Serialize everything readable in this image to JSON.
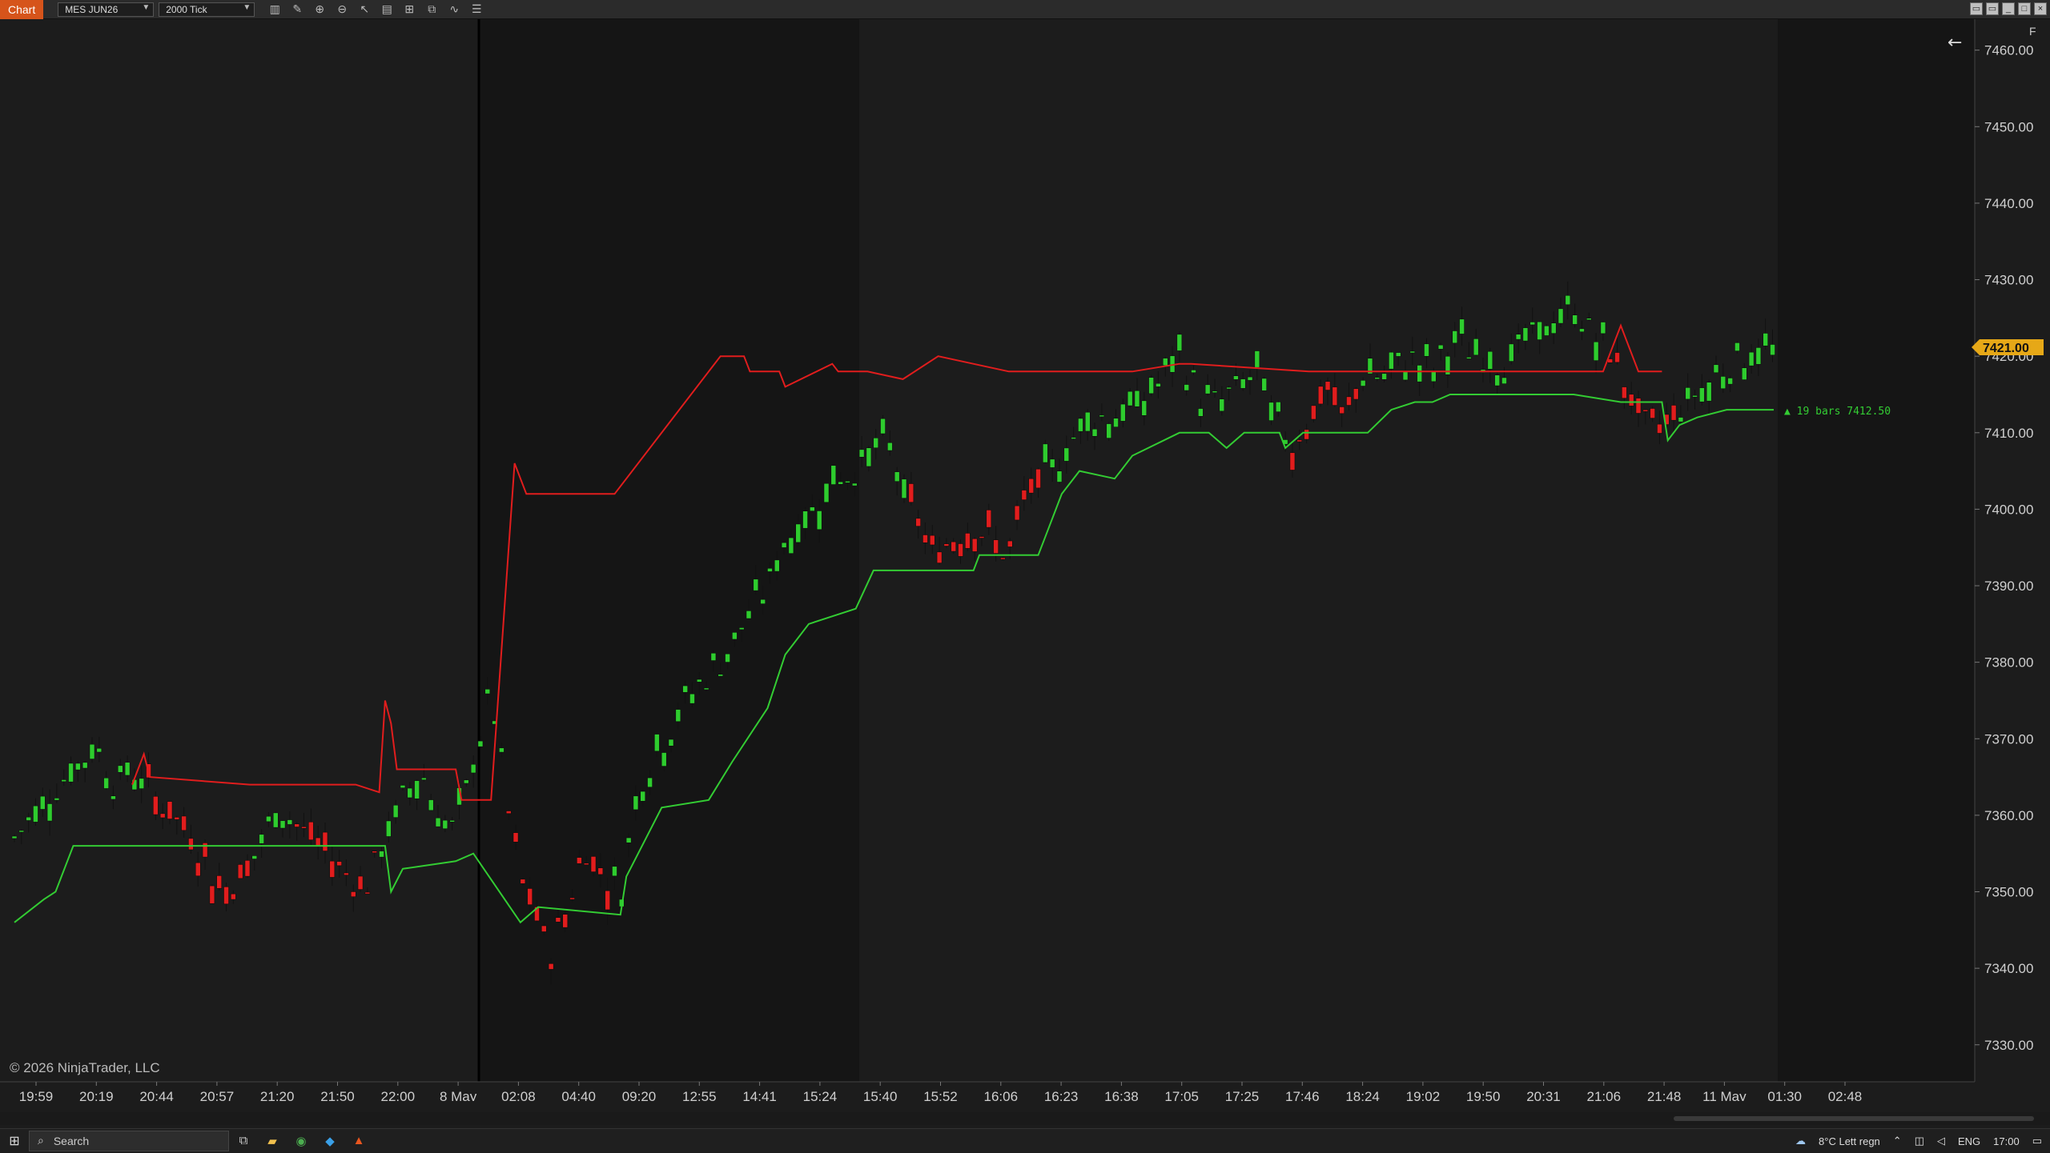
{
  "toolbar": {
    "chart_tab": "Chart",
    "instrument": "MES JUN26",
    "interval": "2000 Tick",
    "icons": [
      "bar-type-icon",
      "draw-tool-icon",
      "zoom-in-icon",
      "zoom-out-icon",
      "pointer-icon",
      "data-box-icon",
      "properties-icon",
      "strategies-icon",
      "indicators-icon",
      "templates-icon"
    ],
    "window_buttons": [
      "tile",
      "tile",
      "minimize",
      "maximize",
      "close"
    ]
  },
  "chart": {
    "copyright": "© 2026 NinjaTrader, LLC",
    "current_price": "7421.00",
    "annotation": "▲ 19 bars  7412.50",
    "back_arrow": "←",
    "corner_label": "F",
    "colors": {
      "up": "#2ecc2e",
      "down": "#e11d1d",
      "price_badge": "#e6a817",
      "background": "#1c1c1c",
      "session_dark": "#161616"
    }
  },
  "chart_data": {
    "type": "candlestick",
    "instrument": "MES JUN26",
    "interval": "2000 Tick",
    "y_ticks": [
      "7460.00",
      "7450.00",
      "7440.00",
      "7430.00",
      "7420.00",
      "7410.00",
      "7400.00",
      "7390.00",
      "7380.00",
      "7370.00",
      "7360.00",
      "7350.00",
      "7340.00",
      "7330.00"
    ],
    "ylim": [
      7326,
      7463
    ],
    "x_ticks": [
      "19:59",
      "20:19",
      "20:44",
      "20:57",
      "21:20",
      "21:50",
      "22:00",
      "8 May",
      "02:08",
      "04:40",
      "09:20",
      "12:55",
      "14:41",
      "15:24",
      "15:40",
      "15:52",
      "16:06",
      "16:23",
      "16:38",
      "17:05",
      "17:25",
      "17:46",
      "18:24",
      "19:02",
      "19:50",
      "20:31",
      "21:06",
      "21:48",
      "11 May",
      "01:30",
      "02:48"
    ],
    "price_path": [
      [
        0,
        7357
      ],
      [
        10,
        7362
      ],
      [
        20,
        7366
      ],
      [
        28,
        7369
      ],
      [
        34,
        7364
      ],
      [
        40,
        7366
      ],
      [
        46,
        7363
      ],
      [
        54,
        7360
      ],
      [
        62,
        7356
      ],
      [
        70,
        7350
      ],
      [
        76,
        7352
      ],
      [
        82,
        7355
      ],
      [
        90,
        7361
      ],
      [
        98,
        7358
      ],
      [
        106,
        7355
      ],
      [
        114,
        7352
      ],
      [
        120,
        7351
      ],
      [
        126,
        7357
      ],
      [
        132,
        7362
      ],
      [
        138,
        7366
      ],
      [
        144,
        7360
      ],
      [
        150,
        7358
      ],
      [
        156,
        7367
      ],
      [
        162,
        7376
      ],
      [
        168,
        7360
      ],
      [
        172,
        7352
      ],
      [
        176,
        7348
      ],
      [
        182,
        7342
      ],
      [
        188,
        7348
      ],
      [
        194,
        7356
      ],
      [
        200,
        7352
      ],
      [
        206,
        7350
      ],
      [
        212,
        7364
      ],
      [
        218,
        7368
      ],
      [
        224,
        7372
      ],
      [
        232,
        7377
      ],
      [
        240,
        7380
      ],
      [
        248,
        7385
      ],
      [
        256,
        7390
      ],
      [
        262,
        7396
      ],
      [
        270,
        7399
      ],
      [
        278,
        7404
      ],
      [
        286,
        7405
      ],
      [
        292,
        7408
      ],
      [
        298,
        7408
      ],
      [
        304,
        7400
      ],
      [
        308,
        7398
      ],
      [
        312,
        7394
      ],
      [
        318,
        7396
      ],
      [
        326,
        7398
      ],
      [
        332,
        7396
      ],
      [
        338,
        7394
      ],
      [
        344,
        7402
      ],
      [
        350,
        7404
      ],
      [
        358,
        7408
      ],
      [
        364,
        7412
      ],
      [
        372,
        7412
      ],
      [
        380,
        7413
      ],
      [
        388,
        7416
      ],
      [
        396,
        7420
      ],
      [
        404,
        7414
      ],
      [
        410,
        7414
      ],
      [
        416,
        7416
      ],
      [
        422,
        7418
      ],
      [
        428,
        7412
      ],
      [
        434,
        7408
      ],
      [
        440,
        7412
      ],
      [
        446,
        7416
      ],
      [
        452,
        7411
      ],
      [
        458,
        7418
      ],
      [
        466,
        7417
      ],
      [
        474,
        7420
      ],
      [
        482,
        7418
      ],
      [
        490,
        7422
      ],
      [
        498,
        7420
      ],
      [
        506,
        7419
      ],
      [
        514,
        7422
      ],
      [
        522,
        7424
      ],
      [
        530,
        7426
      ],
      [
        538,
        7422
      ],
      [
        544,
        7420
      ],
      [
        550,
        7414
      ],
      [
        556,
        7410
      ],
      [
        562,
        7412
      ],
      [
        568,
        7414
      ],
      [
        574,
        7416
      ],
      [
        580,
        7418
      ],
      [
        586,
        7420
      ],
      [
        592,
        7420
      ],
      [
        598,
        7421
      ]
    ],
    "stop_line": {
      "green": [
        [
          0,
          7346
        ],
        [
          10,
          7349
        ],
        [
          14,
          7350
        ],
        [
          20,
          7356
        ],
        [
          50,
          7356
        ],
        [
          70,
          7356
        ],
        [
          126,
          7356
        ],
        [
          128,
          7350
        ],
        [
          132,
          7353
        ],
        [
          150,
          7354
        ],
        [
          156,
          7355
        ],
        [
          172,
          7346
        ],
        [
          178,
          7348
        ],
        [
          206,
          7347
        ],
        [
          208,
          7352
        ],
        [
          220,
          7361
        ],
        [
          236,
          7362
        ],
        [
          244,
          7367
        ],
        [
          256,
          7374
        ],
        [
          262,
          7381
        ],
        [
          270,
          7385
        ],
        [
          286,
          7387
        ],
        [
          292,
          7392
        ],
        [
          306,
          7392
        ],
        [
          312,
          7392
        ],
        [
          326,
          7392
        ],
        [
          328,
          7394
        ],
        [
          348,
          7394
        ],
        [
          350,
          7396
        ],
        [
          356,
          7402
        ],
        [
          362,
          7405
        ],
        [
          374,
          7404
        ],
        [
          380,
          7407
        ],
        [
          396,
          7410
        ],
        [
          402,
          7410
        ],
        [
          406,
          7410
        ],
        [
          412,
          7408
        ],
        [
          418,
          7410
        ],
        [
          430,
          7410
        ],
        [
          432,
          7408
        ],
        [
          438,
          7410
        ],
        [
          460,
          7410
        ],
        [
          468,
          7413
        ],
        [
          476,
          7414
        ],
        [
          482,
          7414
        ],
        [
          488,
          7415
        ],
        [
          500,
          7415
        ],
        [
          530,
          7415
        ],
        [
          546,
          7414
        ],
        [
          560,
          7414
        ],
        [
          562,
          7409
        ],
        [
          566,
          7411
        ],
        [
          572,
          7412
        ],
        [
          582,
          7413
        ],
        [
          598,
          7413
        ]
      ],
      "red": [
        [
          40,
          7364
        ],
        [
          44,
          7368
        ],
        [
          46,
          7365
        ],
        [
          80,
          7364
        ],
        [
          90,
          7364
        ],
        [
          100,
          7364
        ],
        [
          116,
          7364
        ],
        [
          124,
          7363
        ],
        [
          126,
          7375
        ],
        [
          128,
          7372
        ],
        [
          130,
          7366
        ],
        [
          150,
          7366
        ],
        [
          152,
          7362
        ],
        [
          162,
          7362
        ],
        [
          170,
          7406
        ],
        [
          174,
          7402
        ],
        [
          200,
          7402
        ],
        [
          204,
          7402
        ],
        [
          236,
          7418
        ],
        [
          240,
          7420
        ],
        [
          248,
          7420
        ],
        [
          250,
          7418
        ],
        [
          260,
          7418
        ],
        [
          262,
          7416
        ],
        [
          278,
          7419
        ],
        [
          280,
          7418
        ],
        [
          290,
          7418
        ],
        [
          302,
          7417
        ],
        [
          314,
          7420
        ],
        [
          338,
          7418
        ],
        [
          342,
          7418
        ],
        [
          350,
          7418
        ],
        [
          360,
          7418
        ],
        [
          380,
          7418
        ],
        [
          396,
          7419
        ],
        [
          400,
          7419
        ],
        [
          440,
          7418
        ],
        [
          446,
          7418
        ],
        [
          452,
          7418
        ],
        [
          456,
          7418
        ],
        [
          460,
          7418
        ],
        [
          470,
          7418
        ],
        [
          480,
          7418
        ],
        [
          486,
          7418
        ],
        [
          490,
          7418
        ],
        [
          506,
          7418
        ],
        [
          520,
          7418
        ],
        [
          530,
          7418
        ],
        [
          540,
          7418
        ],
        [
          546,
          7424
        ],
        [
          552,
          7418
        ],
        [
          560,
          7418
        ]
      ]
    }
  },
  "taskbar": {
    "search_placeholder": "Search",
    "weather": "8°C  Lett regn",
    "language": "ENG",
    "time": "17:00"
  }
}
